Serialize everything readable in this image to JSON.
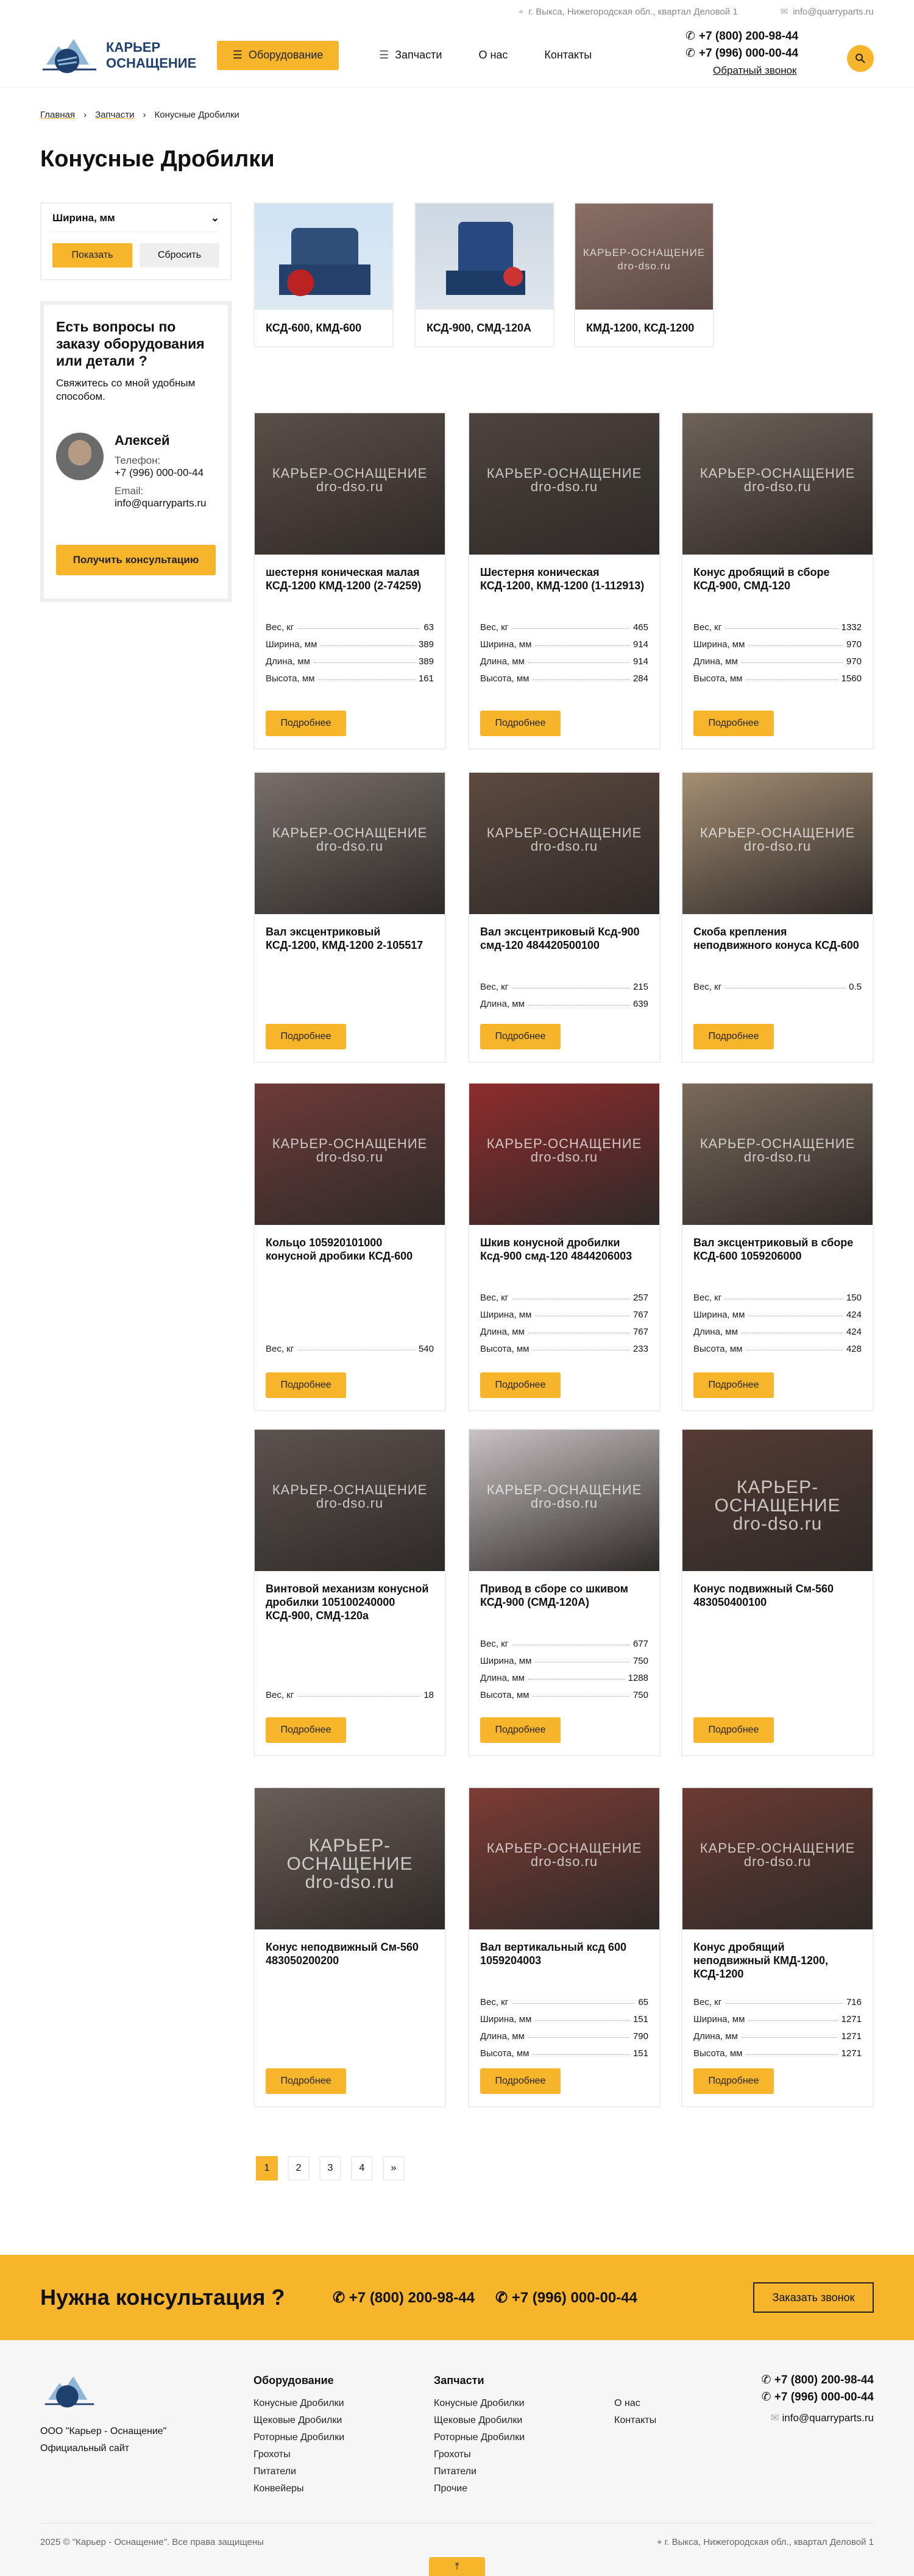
{
  "topbar": {
    "address": "г. Выкса, Нижегородская обл., квартал Деловой 1",
    "email": "info@quarryparts.ru"
  },
  "header": {
    "logo_line1": "КАРЬЕР",
    "logo_line2": "ОСНАЩЕНИЕ",
    "equipment_label": "Оборудование",
    "nav": [
      "Запчасти",
      "О нас",
      "Контакты"
    ],
    "phone1": "+7 (800) 200-98-44",
    "phone2": "+7 (996) 000-00-44",
    "callback": "Обратный звонок"
  },
  "breadcrumbs": [
    "Главная",
    "Запчасти",
    "Конусные Дробилки"
  ],
  "title": "Конусные Дробилки",
  "filter": {
    "label": "Ширина, мм",
    "show": "Показать",
    "reset": "Сбросить"
  },
  "ask": {
    "title": "Есть вопросы по заказу оборудования или детали ?",
    "subtitle": "Свяжитесь со мной удобным способом.",
    "name": "Алексей",
    "phone_label": "Телефон:",
    "phone": "+7 (996) 000-00-44",
    "email_label": "Email:",
    "email": "info@quarryparts.ru",
    "button": "Получить консультацию"
  },
  "categories": [
    "КСД-600, КМД-600",
    "КСД-900, СМД-120А",
    "КМД-1200, КСД-1200"
  ],
  "watermark": {
    "line1": "КАРЬЕР-ОСНАЩЕНИЕ",
    "line2": "dro-dso.ru"
  },
  "details_label": "Подробнее",
  "products": [
    {
      "title": "шестерня коническая малая КСД-1200 КМД-1200 (2-74259)",
      "specs": [
        [
          "Вес, кг",
          "63"
        ],
        [
          "Ширина, мм",
          "389"
        ],
        [
          "Длина, мм",
          "389"
        ],
        [
          "Высота, мм",
          "161"
        ]
      ]
    },
    {
      "title": "Шестерня коническая КСД-1200, КМД-1200 (1-112913)",
      "specs": [
        [
          "Вес, кг",
          "465"
        ],
        [
          "Ширина, мм",
          "914"
        ],
        [
          "Длина, мм",
          "914"
        ],
        [
          "Высота, мм",
          "284"
        ]
      ]
    },
    {
      "title": "Конус дробящий в сборе КСД-900, СМД-120",
      "specs": [
        [
          "Вес, кг",
          "1332"
        ],
        [
          "Ширина, мм",
          "970"
        ],
        [
          "Длина, мм",
          "970"
        ],
        [
          "Высота, мм",
          "1560"
        ]
      ]
    },
    {
      "title": "Вал эксцентриковый КСД-1200, КМД-1200 2-105517",
      "specs": []
    },
    {
      "title": "Вал эксцентриковый Ксд-900 смд-120 484420500100",
      "specs": [
        [
          "Вес, кг",
          "215"
        ],
        [
          "Длина, мм",
          "639"
        ]
      ]
    },
    {
      "title": "Скоба крепления неподвижного конуса КСД-600",
      "specs": [
        [
          "Вес, кг",
          "0.5"
        ]
      ]
    },
    {
      "title": "Кольцо 105920101000 конусной дробики КСД-600",
      "specs": [
        [
          "Вес, кг",
          "540"
        ]
      ]
    },
    {
      "title": "Шкив конусной дробилки Ксд-900 смд-120 4844206003",
      "specs": [
        [
          "Вес, кг",
          "257"
        ],
        [
          "Ширина, мм",
          "767"
        ],
        [
          "Длина, мм",
          "767"
        ],
        [
          "Высота, мм",
          "233"
        ]
      ]
    },
    {
      "title": "Вал эксцентриковый в сборе КСД-600 1059206000",
      "specs": [
        [
          "Вес, кг",
          "150"
        ],
        [
          "Ширина, мм",
          "424"
        ],
        [
          "Длина, мм",
          "424"
        ],
        [
          "Высота, мм",
          "428"
        ]
      ]
    },
    {
      "title": "Винтовой механизм конусной дробилки 105100240000 КСД-900, СМД-120а",
      "specs": [
        [
          "Вес, кг",
          "18"
        ]
      ]
    },
    {
      "title": "Привод в сборе со шкивом КСД-900 (СМД-120А)",
      "specs": [
        [
          "Вес, кг",
          "677"
        ],
        [
          "Ширина, мм",
          "750"
        ],
        [
          "Длина, мм",
          "1288"
        ],
        [
          "Высота, мм",
          "750"
        ]
      ]
    },
    {
      "title": "Конус подвижный См-560 483050400100",
      "specs": []
    },
    {
      "title": "Конус неподвижный См-560 483050200200",
      "specs": []
    },
    {
      "title": "Вал вертикальный ксд 600 1059204003",
      "specs": [
        [
          "Вес, кг",
          "65"
        ],
        [
          "Ширина, мм",
          "151"
        ],
        [
          "Длина, мм",
          "790"
        ],
        [
          "Высота, мм",
          "151"
        ]
      ]
    },
    {
      "title": "Конус дробящий неподвижный КМД-1200, КСД-1200",
      "specs": [
        [
          "Вес, кг",
          "716"
        ],
        [
          "Ширина, мм",
          "1271"
        ],
        [
          "Длина, мм",
          "1271"
        ],
        [
          "Высота, мм",
          "1271"
        ]
      ]
    }
  ],
  "pagination": [
    "1",
    "2",
    "3",
    "4",
    "»"
  ],
  "consult": {
    "title": "Нужна консультация ?",
    "phone1": "+7 (800) 200-98-44",
    "phone2": "+7 (996) 000-00-44",
    "order": "Заказать звонок"
  },
  "footer": {
    "company": "ООО \"Карьер - Оснащение\"",
    "official": "Официальный сайт",
    "col1_title": "Оборудование",
    "col1": [
      "Конусные Дробилки",
      "Щековые Дробилки",
      "Роторные Дробилки",
      "Грохоты",
      "Питатели",
      "Конвейеры"
    ],
    "col2_title": "Запчасти",
    "col2": [
      "Конусные Дробилки",
      "Щековые Дробилки",
      "Роторные Дробилки",
      "Грохоты",
      "Питатели",
      "Прочие"
    ],
    "col3": [
      "О нас",
      "Контакты"
    ],
    "phone1": "+7 (800) 200-98-44",
    "phone2": "+7 (996) 000-00-44",
    "email": "info@quarryparts.ru",
    "copyright": "2025 © \"Карьер - Оснащение\". Все права защищены",
    "address": "г. Выкса, Нижегородская обл., квартал Деловой 1"
  }
}
